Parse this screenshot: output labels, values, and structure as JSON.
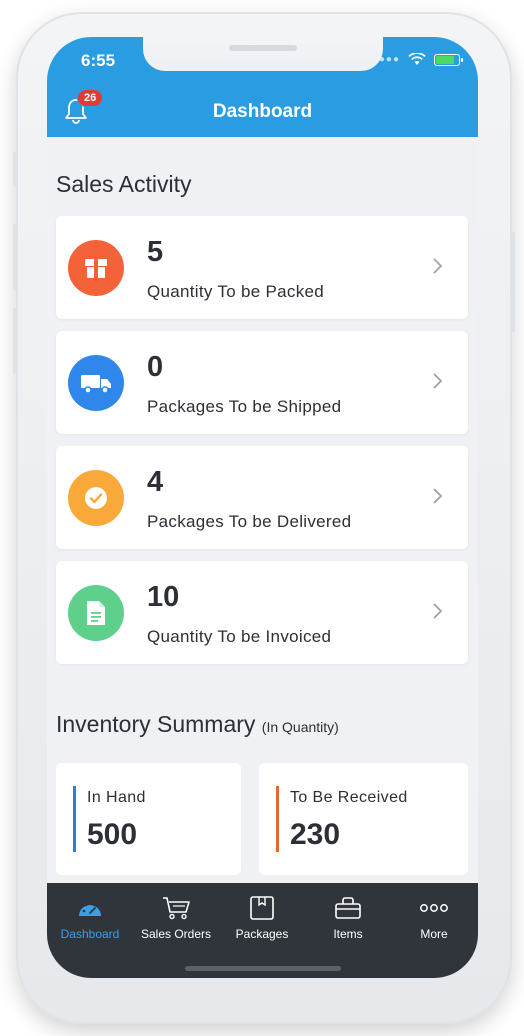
{
  "status": {
    "time": "6:55"
  },
  "header": {
    "title": "Dashboard",
    "notification_count": "26"
  },
  "sales_activity": {
    "title": "Sales Activity",
    "items": [
      {
        "value": "5",
        "label": "Quantity To be Packed",
        "icon": "package-box-icon",
        "color": "#f4623a"
      },
      {
        "value": "0",
        "label": "Packages To be Shipped",
        "icon": "truck-icon",
        "color": "#2f86eb"
      },
      {
        "value": "4",
        "label": "Packages To be Delivered",
        "icon": "checkmark-icon",
        "color": "#f8a93a"
      },
      {
        "value": "10",
        "label": "Quantity To be Invoiced",
        "icon": "document-icon",
        "color": "#5fcf8c"
      }
    ]
  },
  "inventory_summary": {
    "title": "Inventory Summary",
    "subtitle": "(In Quantity)",
    "in_hand": {
      "label": "In Hand",
      "value": "500",
      "color": "#2a80d6"
    },
    "to_be_received": {
      "label": "To Be Received",
      "value": "230",
      "color": "#e0692e"
    }
  },
  "tabbar": {
    "items": [
      {
        "label": "Dashboard",
        "icon": "dashboard-gauge-icon",
        "active": true
      },
      {
        "label": "Sales Orders",
        "icon": "cart-icon",
        "active": false
      },
      {
        "label": "Packages",
        "icon": "package-icon",
        "active": false
      },
      {
        "label": "Items",
        "icon": "basket-icon",
        "active": false
      },
      {
        "label": "More",
        "icon": "more-dots-icon",
        "active": false
      }
    ]
  }
}
